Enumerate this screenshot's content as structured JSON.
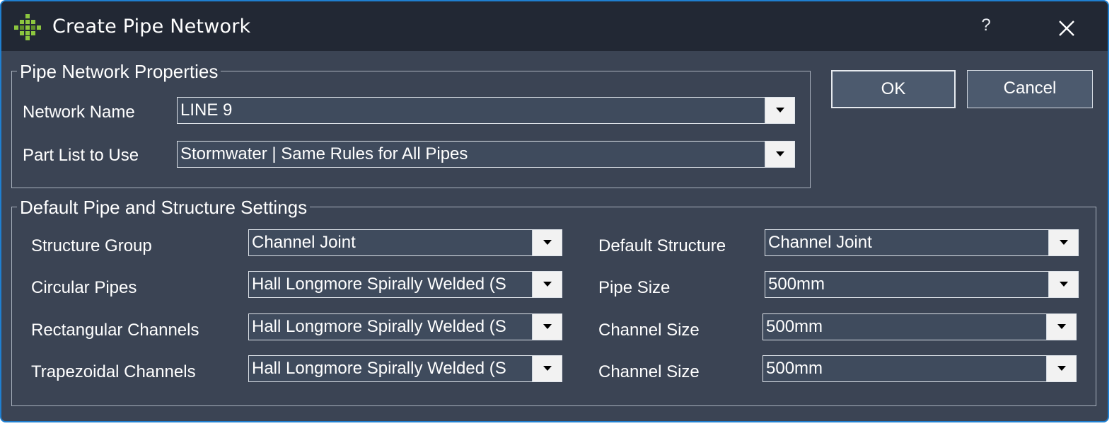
{
  "window": {
    "title": "Create Pipe Network",
    "help_label": "?"
  },
  "buttons": {
    "ok_label": "OK",
    "cancel_label": "Cancel"
  },
  "pipe_network_properties": {
    "title": "Pipe Network Properties",
    "network_name": {
      "label": "Network Name",
      "value": "LINE 9"
    },
    "part_list": {
      "label": "Part List to Use",
      "value": "Stormwater | Same Rules for All Pipes"
    }
  },
  "default_settings": {
    "title": "Default Pipe and Structure Settings",
    "structure_group": {
      "label": "Structure Group",
      "value": "Channel Joint"
    },
    "circular_pipes": {
      "label": "Circular Pipes",
      "value": "Hall Longmore Spirally Welded (S"
    },
    "rectangular_channels": {
      "label": "Rectangular Channels",
      "value": "Hall Longmore Spirally Welded (S"
    },
    "trapezoidal_channels": {
      "label": "Trapezoidal Channels",
      "value": "Hall Longmore Spirally Welded (S"
    },
    "default_structure": {
      "label": "Default Structure",
      "value": "Channel Joint"
    },
    "pipe_size": {
      "label": "Pipe Size",
      "value": "500mm"
    },
    "rect_channel_size": {
      "label": "Channel Size",
      "value": "500mm"
    },
    "trap_channel_size": {
      "label": "Channel Size",
      "value": "500mm"
    }
  },
  "icons": {
    "app": "pipe-network-app-icon",
    "close": "close-icon",
    "dropdown": "chevron-down-icon"
  },
  "colors": {
    "accent_border": "#1f7fd0",
    "titlebar": "#222834",
    "background": "#3b4454",
    "app_icon_green": "#8cc63f"
  }
}
